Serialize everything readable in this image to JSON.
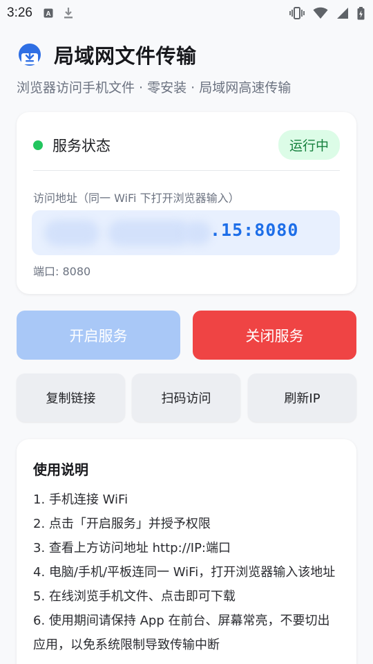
{
  "status_bar": {
    "time": "3:26"
  },
  "header": {
    "title": "局域网文件传输",
    "subtitle": "浏览器访问手机文件 · 零安装 · 局域网高速传输"
  },
  "status_card": {
    "label": "服务状态",
    "badge": "运行中",
    "address_label": "访问地址（同一 WiFi 下打开浏览器输入）",
    "address_visible": ".15:8080",
    "port": "端口: 8080",
    "colors": {
      "online": "#22c55e",
      "badge_bg": "#dcfce7",
      "badge_text": "#15803d",
      "address": "#1d6ee8"
    }
  },
  "actions": {
    "start_label": "开启服务",
    "stop_label": "关闭服务",
    "copy_label": "复制链接",
    "qr_label": "扫码访问",
    "refresh_label": "刷新IP"
  },
  "help": {
    "title": "使用说明",
    "items": [
      "1. 手机连接 WiFi",
      "2. 点击「开启服务」并授予权限",
      "3. 查看上方访问地址 http://IP:端口",
      "4. 电脑/手机/平板连同一 WiFi，打开浏览器输入该地址",
      "5. 在线浏览手机文件、点击即可下载",
      "6. 使用期间请保持 App 在前台、屏幕常亮，不要切出应用，以免系统限制导致传输中断"
    ]
  },
  "icons": [
    "text-a-icon",
    "download-icon",
    "vibrate-icon",
    "wifi-icon",
    "signal-icon",
    "battery-icon",
    "app-logo-download-icon"
  ]
}
